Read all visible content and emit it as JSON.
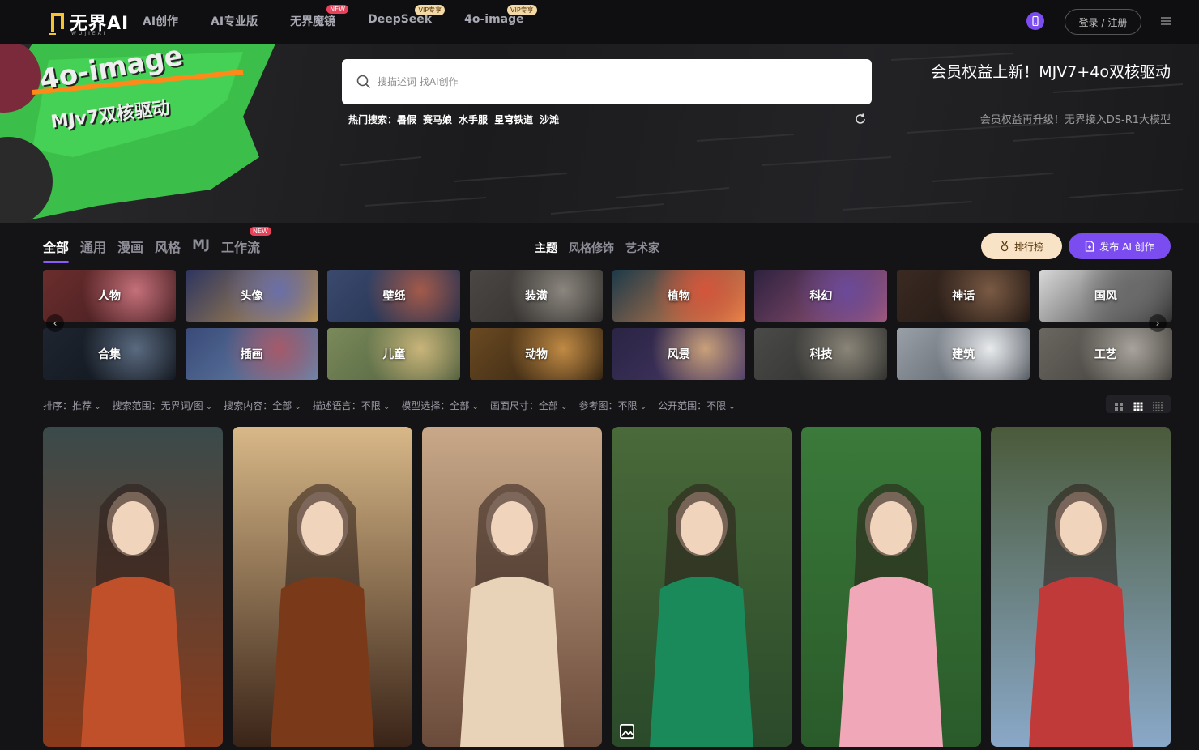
{
  "brand": {
    "name": "无界AI",
    "sub": "WUJIEAI"
  },
  "nav": [
    {
      "label": "AI创作",
      "badge": ""
    },
    {
      "label": "AI专业版",
      "badge": ""
    },
    {
      "label": "无界魔镜",
      "badge": "NEW"
    },
    {
      "label": "DeepSeek",
      "badge": "VIP专享"
    },
    {
      "label": "4o-image",
      "badge": "VIP专享"
    }
  ],
  "header": {
    "login_label": "登录 / 注册"
  },
  "hero": {
    "banner_line1": "4o-image",
    "banner_line2": "MJv7双核驱动",
    "search_placeholder": "搜描述词 找AI创作",
    "hot_label": "热门搜索：",
    "hot_terms": [
      "暑假",
      "赛马娘",
      "水手服",
      "星穹铁道",
      "沙滩"
    ],
    "promo_title": "会员权益上新！MJV7+4o双核驱动",
    "promo_sub": "会员权益再升级！无界接入DS-R1大模型"
  },
  "tabs": [
    {
      "label": "全部"
    },
    {
      "label": "通用"
    },
    {
      "label": "漫画"
    },
    {
      "label": "风格"
    },
    {
      "label": "MJ"
    },
    {
      "label": "工作流",
      "badge": "NEW"
    }
  ],
  "subtabs": [
    "主题",
    "风格修饰",
    "艺术家"
  ],
  "actions": {
    "rank_label": "排行榜",
    "publish_label": "发布 AI 创作"
  },
  "categories": [
    {
      "label": "人物",
      "colors": [
        "#6b2d2d",
        "#c4707a",
        "#3c1b1e"
      ]
    },
    {
      "label": "头像",
      "colors": [
        "#2d3560",
        "#6a6fa8",
        "#c99a4a"
      ]
    },
    {
      "label": "壁纸",
      "colors": [
        "#3a4a6e",
        "#a35a4a",
        "#1f2b48"
      ]
    },
    {
      "label": "装潢",
      "colors": [
        "#4a4744",
        "#8b867e",
        "#2c2a28"
      ]
    },
    {
      "label": "植物",
      "colors": [
        "#1d3a4a",
        "#d4553b",
        "#f08a4a"
      ]
    },
    {
      "label": "科幻",
      "colors": [
        "#2e2240",
        "#6b4a9a",
        "#a55a7a"
      ]
    },
    {
      "label": "神话",
      "colors": [
        "#3a2a22",
        "#7a5a44",
        "#1c1410"
      ]
    },
    {
      "label": "国风",
      "colors": [
        "#d8d8d8",
        "#6a6a6a",
        "#2a2a2a"
      ]
    },
    {
      "label": "合集",
      "colors": [
        "#1e2530",
        "#5a6a80",
        "#0e1218"
      ]
    },
    {
      "label": "插画",
      "colors": [
        "#3a4a78",
        "#a55a6a",
        "#6a8ab0"
      ]
    },
    {
      "label": "儿童",
      "colors": [
        "#7a8a5a",
        "#c9b47a",
        "#4a5a3a"
      ]
    },
    {
      "label": "动物",
      "colors": [
        "#6a4a22",
        "#c08a44",
        "#2a1c0e"
      ]
    },
    {
      "label": "风景",
      "colors": [
        "#2a2444",
        "#c9a07a",
        "#4a3a6a"
      ]
    },
    {
      "label": "科技",
      "colors": [
        "#4a4a48",
        "#8a8578",
        "#2a2a28"
      ]
    },
    {
      "label": "建筑",
      "colors": [
        "#9aa0a8",
        "#e8eaec",
        "#4a5058"
      ]
    },
    {
      "label": "工艺",
      "colors": [
        "#6a6660",
        "#a8a49c",
        "#3a3834"
      ]
    }
  ],
  "filters": [
    "排序：推荐",
    "搜索范围：无界词/图",
    "搜索内容：全部",
    "描述语言：不限",
    "模型选择：全部",
    "画面尺寸：全部",
    "参考图：不限",
    "公开范围：不限"
  ],
  "gallery": [
    {
      "name": "tiger-forest",
      "colors": [
        "#3a4a4a",
        "#c0502a",
        "#8a3a1a"
      ]
    },
    {
      "name": "girl-brown-sweater",
      "colors": [
        "#d8b888",
        "#7a3a1a",
        "#3a2418"
      ]
    },
    {
      "name": "girl-beige-top",
      "colors": [
        "#c8a888",
        "#e8d2b8",
        "#6a4a3a"
      ]
    },
    {
      "name": "girl-green-dress",
      "colors": [
        "#4a6a3a",
        "#1a8a5a",
        "#2a4a2a"
      ]
    },
    {
      "name": "girls-lotus-pink",
      "colors": [
        "#3a7a3a",
        "#f0a8b8",
        "#2a5a2a"
      ]
    },
    {
      "name": "girl-red-plaid",
      "colors": [
        "#4a5a3a",
        "#c03a3a",
        "#8aa8c8"
      ]
    }
  ]
}
